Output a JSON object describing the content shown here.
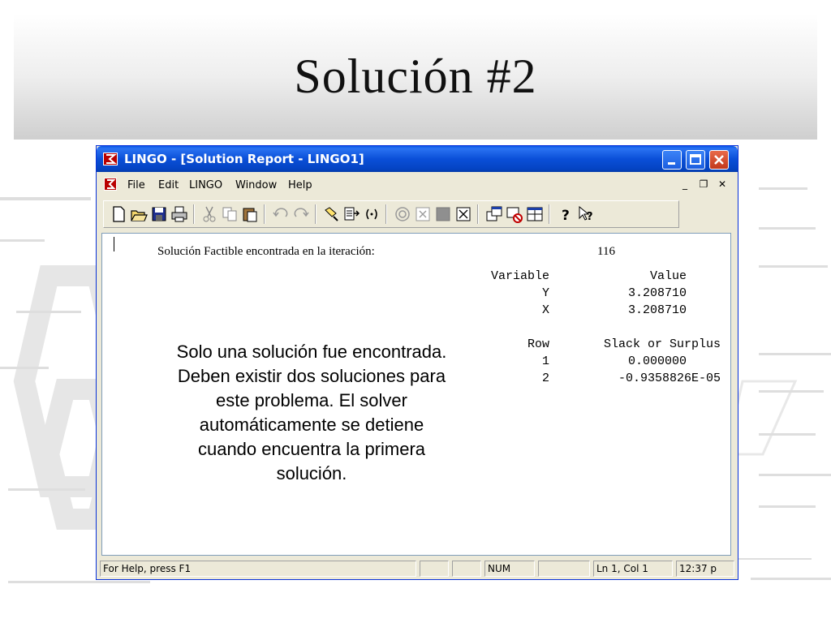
{
  "slide": {
    "title": "Solución #2",
    "callout_lines": [
      "Solo una solución fue encontrada.",
      "Deben existir dos soluciones para",
      "este problema. El solver",
      "automáticamente se detiene",
      "cuando encuentra la primera",
      "solución."
    ]
  },
  "window": {
    "title": "LINGO - [Solution Report - LINGO1]",
    "menu": [
      "File",
      "Edit",
      "LINGO",
      "Window",
      "Help"
    ],
    "mdi_controls": [
      "_",
      "❐",
      "✕"
    ],
    "toolbar_icons": [
      "new-file-icon",
      "open-folder-icon",
      "save-icon",
      "print-icon",
      "cut-icon",
      "copy-icon",
      "paste-icon",
      "undo-icon",
      "redo-icon",
      "find-icon",
      "goto-line-icon",
      "match-parenthesis-icon",
      "solve-icon",
      "solution-icon",
      "matrix-picture-icon",
      "options-icon",
      "send-to-back-icon",
      "close-all-icon",
      "tile-icon",
      "help-icon",
      "context-help-icon"
    ]
  },
  "report": {
    "iteration_label": "Solución Factible encontrada en la iteración:",
    "iteration_value": "116",
    "variables_header": {
      "name": "Variable",
      "value": "Value"
    },
    "variables": [
      {
        "name": "Y",
        "value": "3.208710"
      },
      {
        "name": "X",
        "value": "3.208710"
      }
    ],
    "rows_header": {
      "row": "Row",
      "slack": "Slack or Surplus"
    },
    "rows": [
      {
        "row": "1",
        "slack": "0.000000"
      },
      {
        "row": "2",
        "slack": "-0.9358826E-05"
      }
    ]
  },
  "statusbar": {
    "help": "For Help, press F1",
    "num": "NUM",
    "position": "Ln 1, Col 1",
    "time": "12:37 p"
  },
  "colors": {
    "titlebar": "#0a4fd8",
    "chrome": "#ece9d8",
    "app_icon": "#b90000"
  }
}
